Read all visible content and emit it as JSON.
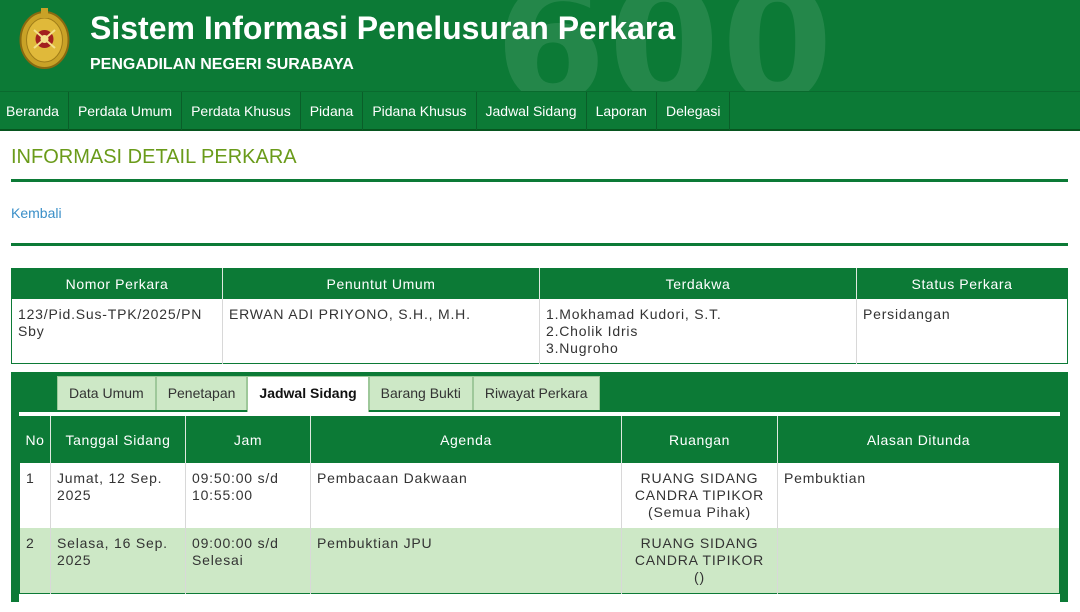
{
  "header": {
    "title": "Sistem Informasi Penelusuran Perkara",
    "subtitle": "PENGADILAN NEGERI SURABAYA",
    "watermark": "600",
    "logo_icon": "court-emblem-icon"
  },
  "nav": {
    "items": [
      "Beranda",
      "Perdata Umum",
      "Perdata Khusus",
      "Pidana",
      "Pidana Khusus",
      "Jadwal Sidang",
      "Laporan",
      "Delegasi"
    ]
  },
  "page": {
    "title": "INFORMASI DETAIL PERKARA",
    "back_label": "Kembali"
  },
  "summary": {
    "headers": [
      "Nomor Perkara",
      "Penuntut Umum",
      "Terdakwa",
      "Status Perkara"
    ],
    "nomor_perkara": "123/Pid.Sus-TPK/2025/PN Sby",
    "penuntut_umum": "ERWAN ADI PRIYONO, S.H., M.H.",
    "terdakwa": [
      "1.Mokhamad Kudori, S.T.",
      "2.Cholik Idris",
      "3.Nugroho"
    ],
    "status": "Persidangan"
  },
  "tabs": [
    "Data Umum",
    "Penetapan",
    "Jadwal Sidang",
    "Barang Bukti",
    "Riwayat Perkara"
  ],
  "active_tab": "Jadwal Sidang",
  "schedule": {
    "headers": {
      "no": "No",
      "tanggal": "Tanggal Sidang",
      "jam": "Jam",
      "agenda": "Agenda",
      "ruangan": "Ruangan",
      "alasan": "Alasan Ditunda"
    },
    "rows": [
      {
        "no": "1",
        "tanggal": "Jumat, 12 Sep. 2025",
        "jam": "09:50:00 s/d 10:55:00",
        "agenda": "Pembacaan Dakwaan",
        "ruangan": "RUANG SIDANG CANDRA TIPIKOR (Semua Pihak)",
        "alasan": "Pembuktian"
      },
      {
        "no": "2",
        "tanggal": "Selasa, 16 Sep. 2025",
        "jam": "09:00:00 s/d Selesai",
        "agenda": "Pembuktian JPU",
        "ruangan": "RUANG SIDANG CANDRA TIPIKOR ()",
        "alasan": ""
      }
    ]
  },
  "colors": {
    "brand_green": "#0c7a36",
    "title_green": "#6a9b1a",
    "link_blue": "#3a8fc8",
    "alt_row": "#cde8c6"
  }
}
